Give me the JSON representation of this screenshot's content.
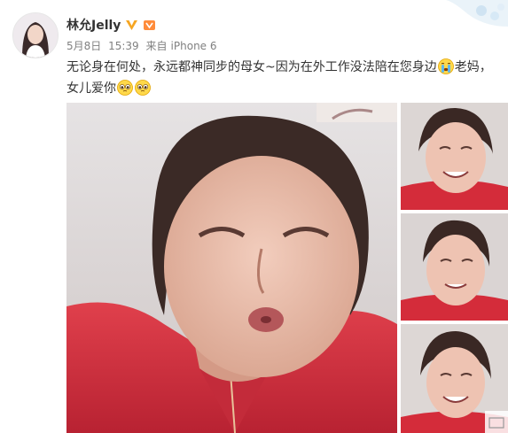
{
  "user": {
    "name": "林允Jelly",
    "avatar_icon": "user-avatar",
    "verified_icon": "verified-v-icon",
    "member_icon": "vip-member-icon"
  },
  "meta": {
    "date": "5月8日",
    "time": "15:39",
    "source_prefix": "来自",
    "source": "iPhone 6"
  },
  "post": {
    "text_part1": "无论身在何处，永远都神同步的母女~因为在外工作没法陪在您身边",
    "text_part2": "老妈，女儿爱你"
  },
  "media": {
    "main_photo_icon": "mother-selfie-photo",
    "thumbnails": [
      "mother-photo-2",
      "mother-photo-3",
      "mother-photo-4"
    ]
  },
  "colors": {
    "name": "#333333",
    "meta": "#808080",
    "verified": "#f6a623",
    "jacket_red": "#d42c3a"
  }
}
